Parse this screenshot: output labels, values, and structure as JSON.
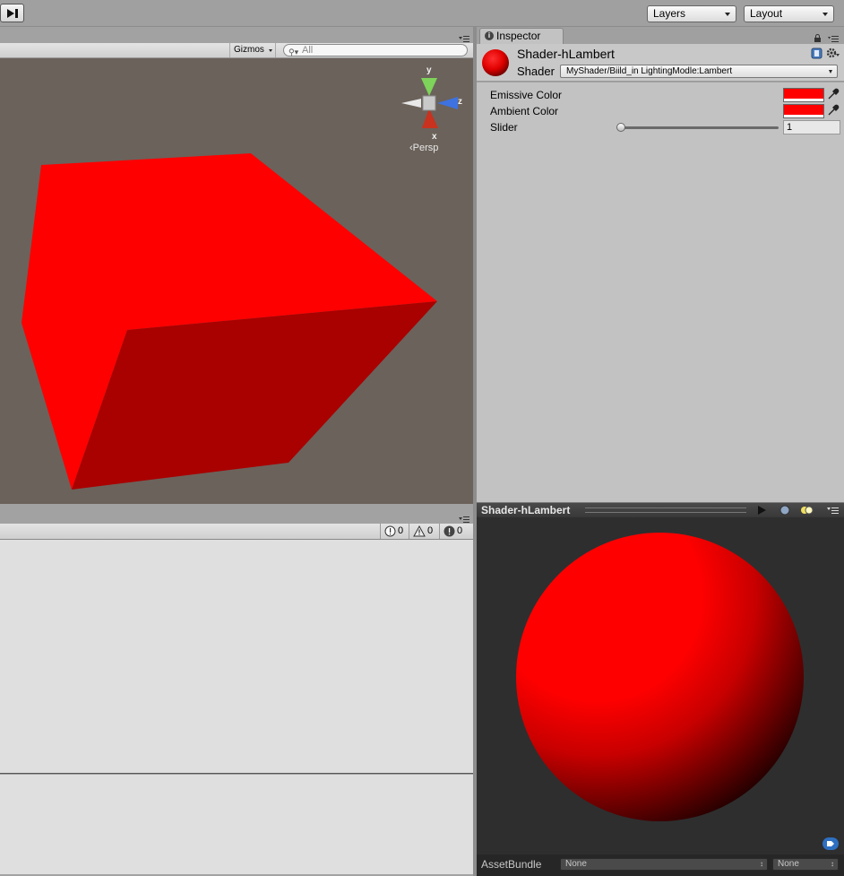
{
  "toolbar": {
    "layers_label": "Layers",
    "layout_label": "Layout"
  },
  "scene": {
    "gizmos_label": "Gizmos",
    "search_placeholder": "All",
    "axes": {
      "y": "y",
      "z": "z",
      "x": "x"
    },
    "projection_label": "Persp",
    "cube_color": "#ff0000",
    "background_color": "#6b625b"
  },
  "console": {
    "log_count": "0",
    "warning_count": "0",
    "error_count": "0"
  },
  "inspector": {
    "tab_label": "Inspector",
    "material_name": "Shader-hLambert",
    "shader_label": "Shader",
    "shader_value": "MyShader/Biild_in LightingModle:Lambert",
    "properties": [
      {
        "label": "Emissive Color",
        "color": "#ff0000"
      },
      {
        "label": "Ambient Color",
        "color": "#ff0000"
      },
      {
        "label": "Slider",
        "value": "1"
      }
    ],
    "slider_fraction": 0.0
  },
  "preview": {
    "title": "Shader-hLambert",
    "assetbundle_label": "AssetBundle",
    "assetbundle_value": "None",
    "variant_value": "None",
    "sphere_color": "#ff0000"
  }
}
